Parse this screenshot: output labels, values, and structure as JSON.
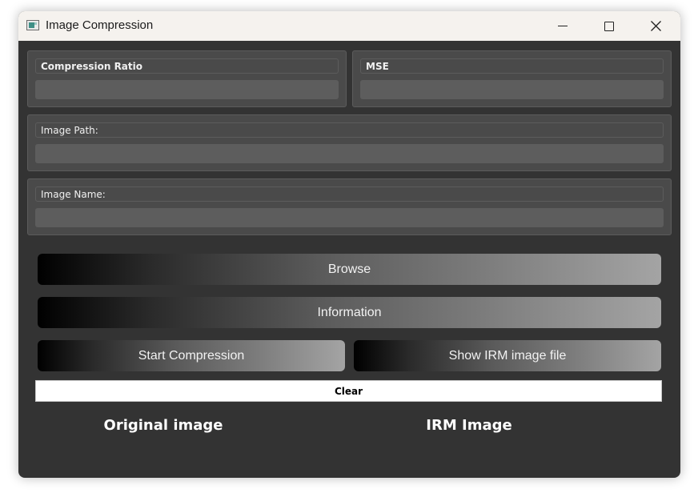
{
  "window": {
    "title": "Image Compression",
    "controls": [
      "minimize",
      "maximize",
      "close"
    ]
  },
  "fields": {
    "compression_ratio": {
      "label": "Compression Ratio",
      "value": ""
    },
    "mse": {
      "label": "MSE",
      "value": ""
    },
    "image_path": {
      "label": "Image Path:",
      "value": ""
    },
    "image_name": {
      "label": "Image Name:",
      "value": ""
    }
  },
  "buttons": {
    "browse": "Browse",
    "information": "Information",
    "start_compression": "Start Compression",
    "show_irm": "Show IRM  image file",
    "clear": "Clear"
  },
  "images": {
    "original_label": "Original image",
    "irm_label": "IRM Image"
  },
  "colors": {
    "window_bg": "#333333",
    "group_bg": "#4a4a4a",
    "field_bg": "#5d5d5d",
    "titlebar_bg": "#f5f2ee"
  }
}
